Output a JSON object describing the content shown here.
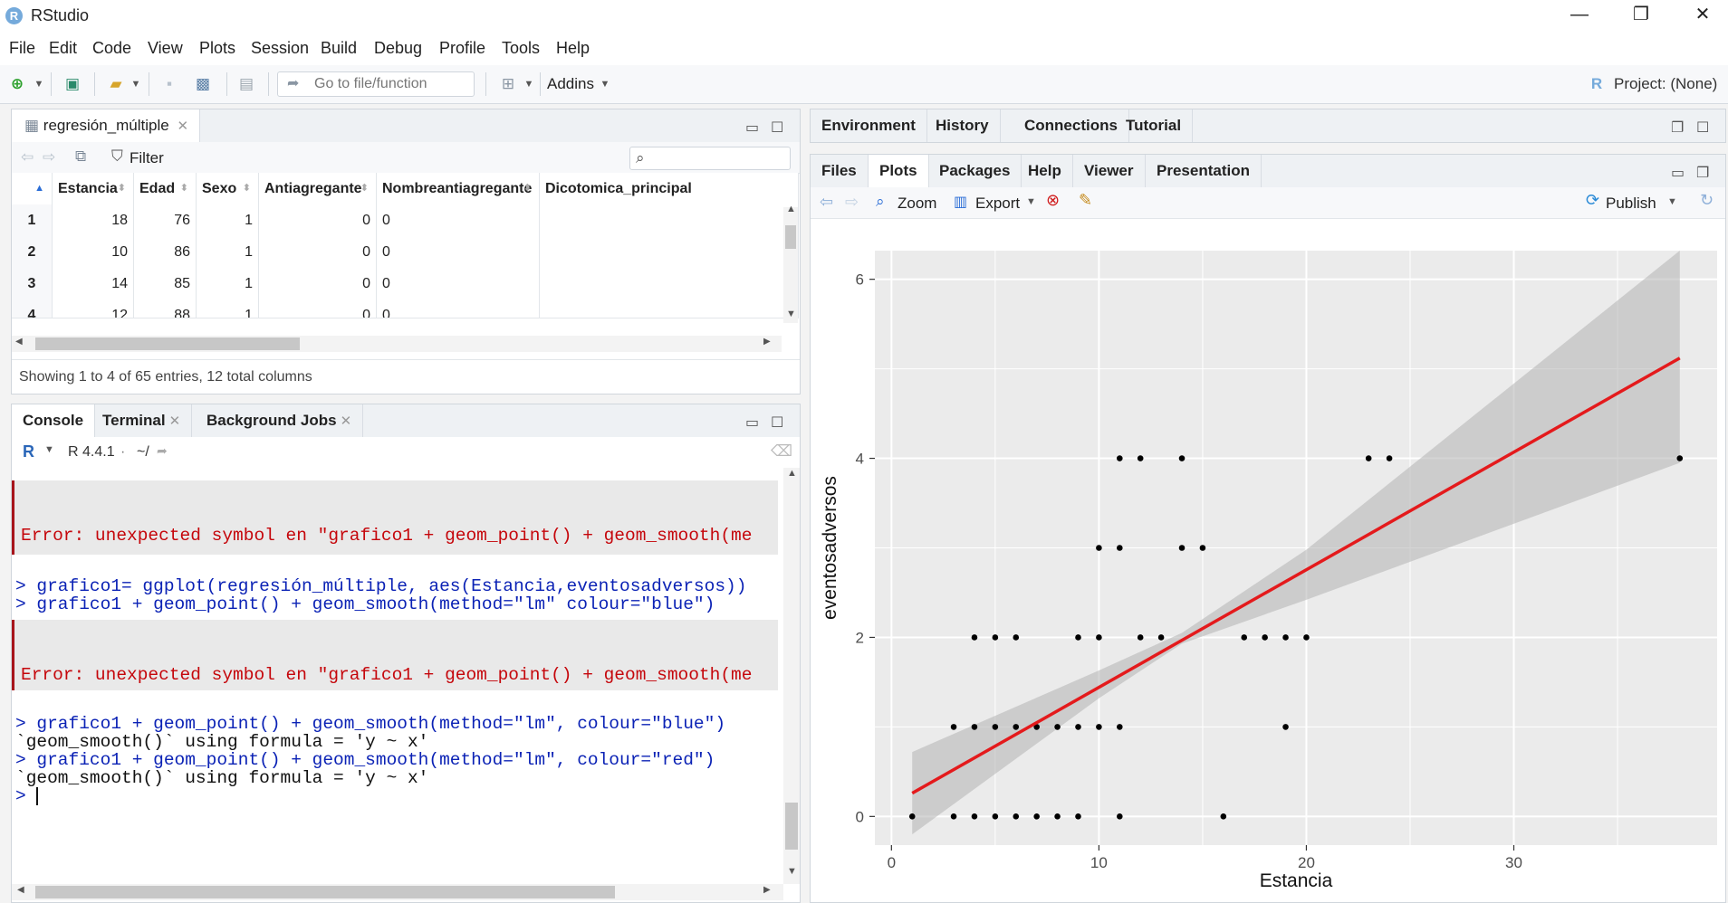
{
  "app": {
    "title": "RStudio",
    "icon": "R"
  },
  "window_controls": {
    "minimize": "—",
    "maximize": "❐",
    "close": "✕"
  },
  "menu": [
    "File",
    "Edit",
    "Code",
    "View",
    "Plots",
    "Session",
    "Build",
    "Debug",
    "Profile",
    "Tools",
    "Help"
  ],
  "toolbar": {
    "goto_placeholder": "Go to file/function",
    "addins": "Addins",
    "project": "Project: (None)"
  },
  "dataviewer": {
    "tab_label": "regresión_múltiple",
    "filter_label": "Filter",
    "columns": [
      "Estancia",
      "Edad",
      "Sexo",
      "Antiagregante",
      "Nombreantiagregante",
      "Dicotomica_principal"
    ],
    "rows": [
      {
        "n": "1",
        "cells": [
          "18",
          "76",
          "1",
          "0",
          "0",
          ""
        ]
      },
      {
        "n": "2",
        "cells": [
          "10",
          "86",
          "1",
          "0",
          "0",
          ""
        ]
      },
      {
        "n": "3",
        "cells": [
          "14",
          "85",
          "1",
          "0",
          "0",
          ""
        ]
      },
      {
        "n": "4",
        "cells": [
          "12",
          "88",
          "1",
          "0",
          "0",
          ""
        ]
      }
    ],
    "status": "Showing 1 to 4 of 65 entries, 12 total columns"
  },
  "console": {
    "tabs": [
      "Console",
      "Terminal",
      "Background Jobs"
    ],
    "r_version": "R 4.4.1",
    "path": "~/",
    "lines": {
      "err1": "Error: unexpected symbol en \"grafico1 + geom_point() + geom_smooth(me",
      "cmd1": "> grafico1= ggplot(regresión_múltiple, aes(Estancia,eventosadversos))",
      "cmd2": "> grafico1 + geom_point() + geom_smooth(method=\"lm\" colour=\"blue\")",
      "err2": "Error: unexpected symbol en \"grafico1 + geom_point() + geom_smooth(me",
      "cmd3": "> grafico1 + geom_point() + geom_smooth(method=\"lm\", colour=\"blue\")",
      "out1": "`geom_smooth()` using formula = 'y ~ x'",
      "cmd4": "> grafico1 + geom_point() + geom_smooth(method=\"lm\", colour=\"red\")",
      "out2": "`geom_smooth()` using formula = 'y ~ x'",
      "prompt": "> "
    }
  },
  "env_tabs": [
    "Environment",
    "History",
    "Connections",
    "Tutorial"
  ],
  "files_tabs": [
    "Files",
    "Plots",
    "Packages",
    "Help",
    "Viewer",
    "Presentation"
  ],
  "plots_toolbar": {
    "zoom": "Zoom",
    "export": "Export",
    "publish": "Publish"
  },
  "colors": {
    "line": "#e41a1c",
    "panel": "#ebebeb",
    "ribbon": "#b3b3b3",
    "point": "#000000"
  },
  "chart_data": {
    "type": "scatter",
    "xlabel": "Estancia",
    "ylabel": "eventosadversos",
    "xlim": [
      -0.8,
      39.8
    ],
    "ylim": [
      -0.32,
      6.32
    ],
    "xticks": [
      0,
      10,
      20,
      30
    ],
    "yticks": [
      0,
      2,
      4,
      6
    ],
    "grid": true,
    "points": [
      [
        1,
        0
      ],
      [
        3,
        0
      ],
      [
        4,
        0
      ],
      [
        5,
        0
      ],
      [
        6,
        0
      ],
      [
        7,
        0
      ],
      [
        8,
        0
      ],
      [
        9,
        0
      ],
      [
        11,
        0
      ],
      [
        16,
        0
      ],
      [
        3,
        1
      ],
      [
        4,
        1
      ],
      [
        5,
        1
      ],
      [
        6,
        1
      ],
      [
        7,
        1
      ],
      [
        8,
        1
      ],
      [
        9,
        1
      ],
      [
        10,
        1
      ],
      [
        11,
        1
      ],
      [
        19,
        1
      ],
      [
        4,
        2
      ],
      [
        5,
        2
      ],
      [
        6,
        2
      ],
      [
        9,
        2
      ],
      [
        10,
        2
      ],
      [
        12,
        2
      ],
      [
        13,
        2
      ],
      [
        17,
        2
      ],
      [
        18,
        2
      ],
      [
        19,
        2
      ],
      [
        20,
        2
      ],
      [
        10,
        3
      ],
      [
        11,
        3
      ],
      [
        14,
        3
      ],
      [
        15,
        3
      ],
      [
        11,
        4
      ],
      [
        12,
        4
      ],
      [
        14,
        4
      ],
      [
        23,
        4
      ],
      [
        24,
        4
      ],
      [
        38,
        4
      ]
    ],
    "smooth": {
      "method": "lm",
      "line": [
        [
          1,
          0.26
        ],
        [
          38,
          5.12
        ]
      ],
      "ribbon_upper": [
        [
          1,
          0.72
        ],
        [
          10,
          1.63
        ],
        [
          14,
          2.05
        ],
        [
          20,
          2.98
        ],
        [
          38,
          6.32
        ]
      ],
      "ribbon_lower": [
        [
          1,
          -0.2
        ],
        [
          10,
          1.32
        ],
        [
          14,
          1.93
        ],
        [
          20,
          2.42
        ],
        [
          38,
          3.95
        ]
      ]
    }
  }
}
